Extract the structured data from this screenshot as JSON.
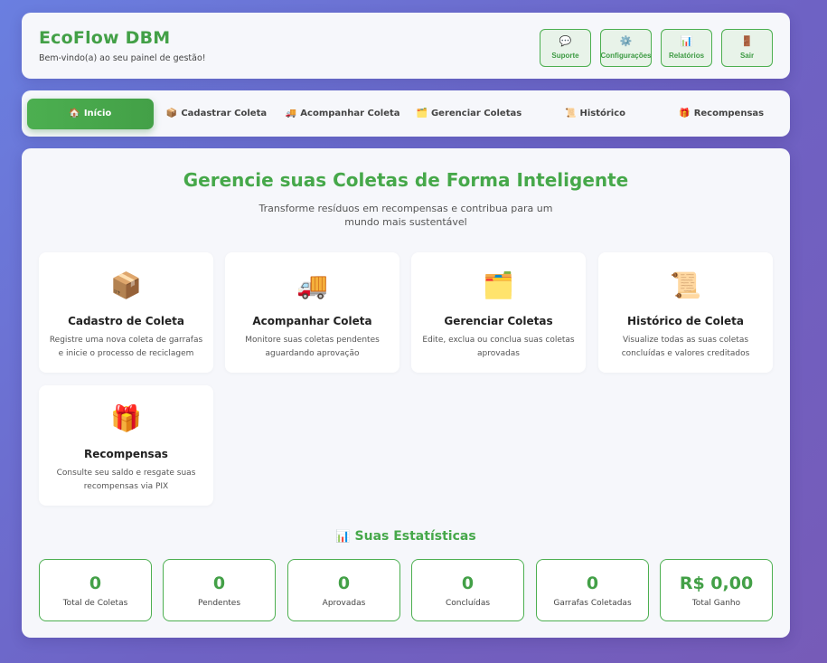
{
  "header": {
    "title": "EcoFlow DBM",
    "subtitle": "Bem-vindo(a) ao seu painel de gestão!",
    "buttons": [
      {
        "label": "Suporte",
        "icon": "💬",
        "icon_name": "speech-bubble-icon"
      },
      {
        "label": "Configurações",
        "icon": "⚙️",
        "icon_name": "gear-icon"
      },
      {
        "label": "Relatórios",
        "icon": "📊",
        "icon_name": "bar-chart-icon"
      },
      {
        "label": "Sair",
        "icon": "🚪",
        "icon_name": "door-icon"
      }
    ]
  },
  "nav": {
    "tabs": [
      {
        "label": "Início",
        "icon": "🏠",
        "icon_name": "house-icon",
        "active": true
      },
      {
        "label": "Cadastrar Coleta",
        "icon": "📦",
        "icon_name": "package-icon",
        "active": false
      },
      {
        "label": "Acompanhar Coleta",
        "icon": "🚚",
        "icon_name": "truck-icon",
        "active": false
      },
      {
        "label": "Gerenciar Coletas",
        "icon": "🗂️",
        "icon_name": "folder-icon",
        "active": false
      },
      {
        "label": "Histórico",
        "icon": "📜",
        "icon_name": "scroll-icon",
        "active": false
      },
      {
        "label": "Recompensas",
        "icon": "🎁",
        "icon_name": "gift-icon",
        "active": false
      }
    ]
  },
  "main": {
    "title": "Gerencie suas Coletas de Forma Inteligente",
    "subtitle": "Transforme resíduos em recompensas e contribua para um mundo mais sustentável",
    "features": [
      {
        "title": "Cadastro de Coleta",
        "desc": "Registre uma nova coleta de garrafas e inicie o processo de reciclagem",
        "icon": "📦",
        "icon_name": "package-icon"
      },
      {
        "title": "Acompanhar Coleta",
        "desc": "Monitore suas coletas pendentes aguardando aprovação",
        "icon": "🚚",
        "icon_name": "truck-icon"
      },
      {
        "title": "Gerenciar Coletas",
        "desc": "Edite, exclua ou conclua suas coletas aprovadas",
        "icon": "🗂️",
        "icon_name": "folder-icon"
      },
      {
        "title": "Histórico de Coleta",
        "desc": "Visualize todas as suas coletas concluídas e valores creditados",
        "icon": "📜",
        "icon_name": "scroll-icon"
      },
      {
        "title": "Recompensas",
        "desc": "Consulte seu saldo e resgate suas recompensas via PIX",
        "icon": "🎁",
        "icon_name": "gift-icon"
      }
    ]
  },
  "stats": {
    "title": "Suas Estatísticas",
    "icon": "📊",
    "items": [
      {
        "value": "0",
        "label": "Total de Coletas"
      },
      {
        "value": "0",
        "label": "Pendentes"
      },
      {
        "value": "0",
        "label": "Aprovadas"
      },
      {
        "value": "0",
        "label": "Concluídas"
      },
      {
        "value": "0",
        "label": "Garrafas Coletadas"
      },
      {
        "value": "R$ 0,00",
        "label": "Total Ganho"
      }
    ]
  },
  "colors": {
    "accent": "#43a047",
    "accent_light": "#e8f3e9",
    "background_start": "#6a7fe0",
    "background_end": "#765bb8"
  }
}
